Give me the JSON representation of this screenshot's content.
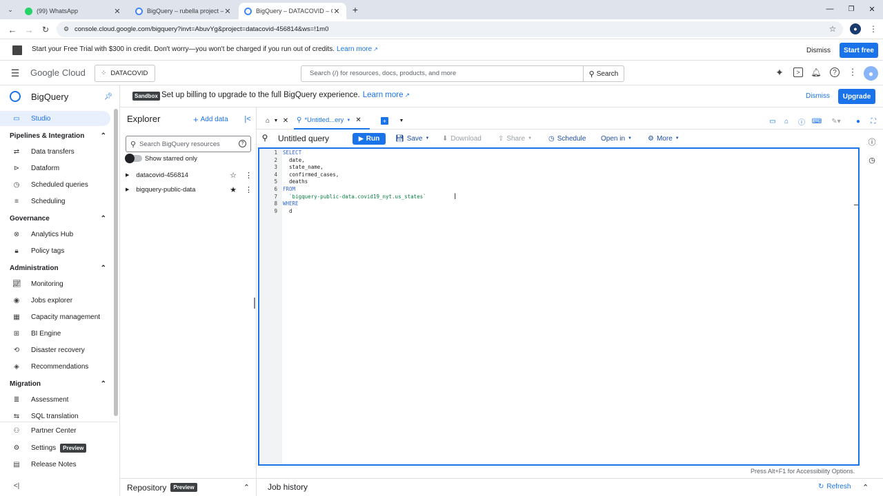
{
  "browser": {
    "tabs": [
      {
        "title": "(99) WhatsApp",
        "favicon_color": "#25d366"
      },
      {
        "title": "BigQuery – rubella project – Go",
        "favicon_color": "#4285f4"
      },
      {
        "title": "BigQuery – DATACOVID – Goog",
        "favicon_color": "#4285f4"
      }
    ],
    "url": "console.cloud.google.com/bigquery?invt=AbuvYg&project=datacovid-456814&ws=!1m0"
  },
  "trial_banner": {
    "text": "Start your Free Trial with $300 in credit. Don't worry—you won't be charged if you run out of credits.",
    "learn_more": "Learn more",
    "dismiss": "Dismiss",
    "start_free": "Start free"
  },
  "header": {
    "logo_google": "Google",
    "logo_cloud": "Cloud",
    "project": "DATACOVID",
    "search_placeholder": "Search (/) for resources, docs, products, and more",
    "search_button": "Search"
  },
  "nav": {
    "product": "BigQuery",
    "studio": "Studio",
    "sections": [
      {
        "title": "Pipelines & Integration",
        "items": [
          "Data transfers",
          "Dataform",
          "Scheduled queries",
          "Scheduling"
        ]
      },
      {
        "title": "Governance",
        "items": [
          "Analytics Hub",
          "Policy tags"
        ]
      },
      {
        "title": "Administration",
        "items": [
          "Monitoring",
          "Jobs explorer",
          "Capacity management",
          "BI Engine",
          "Disaster recovery",
          "Recommendations"
        ]
      },
      {
        "title": "Migration",
        "items": [
          "Assessment",
          "SQL translation"
        ]
      }
    ],
    "partner_center": "Partner Center",
    "settings": "Settings",
    "settings_badge": "Preview",
    "release_notes": "Release Notes"
  },
  "sandbox": {
    "badge": "Sandbox",
    "text": "Set up billing to upgrade to the full BigQuery experience.",
    "learn_more": "Learn more",
    "dismiss": "Dismiss",
    "upgrade": "Upgrade"
  },
  "explorer": {
    "title": "Explorer",
    "add_data": "Add data",
    "search_placeholder": "Search BigQuery resources",
    "starred_only": "Show starred only",
    "projects": [
      "datacovid-456814",
      "bigquery-public-data"
    ],
    "repository": "Repository",
    "repository_badge": "Preview"
  },
  "editor": {
    "tab_title": "*Untitled...ery",
    "query_title": "Untitled query",
    "run": "Run",
    "save": "Save",
    "download": "Download",
    "share": "Share",
    "schedule": "Schedule",
    "open_in": "Open in",
    "more": "More",
    "line_numbers": [
      "1",
      "2",
      "3",
      "4",
      "5",
      "6",
      "7",
      "8",
      "9"
    ],
    "code_lines": [
      {
        "text": "SELECT",
        "class": "kw"
      },
      {
        "text": "  date,",
        "class": ""
      },
      {
        "text": "  state_name,",
        "class": ""
      },
      {
        "text": "  confirmed_cases,",
        "class": ""
      },
      {
        "text": "  deaths",
        "class": ""
      },
      {
        "text": "FROM",
        "class": "kw"
      },
      {
        "text": "  `bigquery-public-data.covid19_nyt.us_states`",
        "class": "str"
      },
      {
        "text": "WHERE",
        "class": "kw"
      },
      {
        "text": "  d",
        "class": ""
      }
    ],
    "accessibility_hint": "Press Alt+F1 for Accessibility Options."
  },
  "job_history": {
    "title": "Job history",
    "refresh": "Refresh"
  },
  "colors": {
    "accent": "#1a73e8",
    "keyword": "#3367d6",
    "string": "#0b8043"
  }
}
